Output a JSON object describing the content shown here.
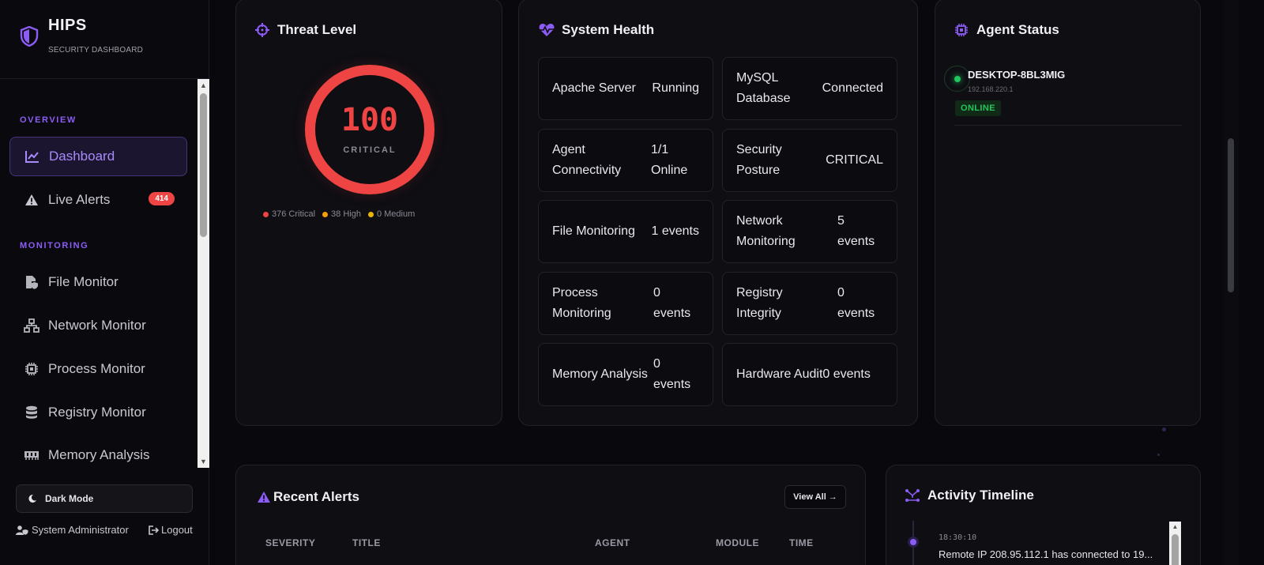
{
  "brand": {
    "title": "HIPS",
    "subtitle": "SECURITY DASHBOARD"
  },
  "sidebar": {
    "sections": [
      {
        "label": "OVERVIEW",
        "items": [
          {
            "label": "Dashboard",
            "icon": "chart-line-icon",
            "active": true
          },
          {
            "label": "Live Alerts",
            "icon": "warning-icon",
            "badge": "414"
          }
        ]
      },
      {
        "label": "MONITORING",
        "items": [
          {
            "label": "File Monitor",
            "icon": "file-shield-icon"
          },
          {
            "label": "Network Monitor",
            "icon": "network-icon"
          },
          {
            "label": "Process Monitor",
            "icon": "cpu-icon"
          },
          {
            "label": "Registry Monitor",
            "icon": "database-icon"
          },
          {
            "label": "Memory Analysis",
            "icon": "memory-icon"
          }
        ]
      }
    ],
    "footer": {
      "dark_mode_label": "Dark Mode",
      "user": "System Administrator",
      "logout": "Logout"
    }
  },
  "threat": {
    "title": "Threat Level",
    "score": "100",
    "level": "CRITICAL",
    "legend": [
      {
        "label": "376 Critical",
        "color": "#ef4444"
      },
      {
        "label": "38 High",
        "color": "#f59e0b"
      },
      {
        "label": "0 Medium",
        "color": "#eab308"
      }
    ]
  },
  "health": {
    "title": "System Health",
    "tiles": [
      {
        "name": "Apache Server",
        "value": "Running"
      },
      {
        "name": "MySQL Database",
        "value": "Connected"
      },
      {
        "name": "Agent Connectivity",
        "value": "1/1 Online"
      },
      {
        "name": "Security Posture",
        "value": "CRITICAL"
      },
      {
        "name": "File Monitoring",
        "value": "1 events"
      },
      {
        "name": "Network Monitoring",
        "value": "5 events"
      },
      {
        "name": "Process Monitoring",
        "value": "0 events"
      },
      {
        "name": "Registry Integrity",
        "value": "0 events"
      },
      {
        "name": "Memory Analysis",
        "value": "0 events"
      },
      {
        "name": "Hardware Audit",
        "value": "0 events"
      }
    ]
  },
  "agents": {
    "title": "Agent Status",
    "list": [
      {
        "name": "DESKTOP-8BL3MIG",
        "ip": "192.168.220.1",
        "status": "ONLINE"
      }
    ]
  },
  "alerts": {
    "title": "Recent Alerts",
    "view_all": "View All →",
    "columns": [
      "SEVERITY",
      "TITLE",
      "AGENT",
      "MODULE",
      "TIME"
    ]
  },
  "timeline": {
    "title": "Activity Timeline",
    "events": [
      {
        "time": "18:30:10",
        "text": "Remote IP 208.95.112.1 has connected to 19..."
      }
    ]
  },
  "colors": {
    "accent": "#8b5cf6",
    "critical": "#ef4444",
    "online": "#22c55e"
  }
}
